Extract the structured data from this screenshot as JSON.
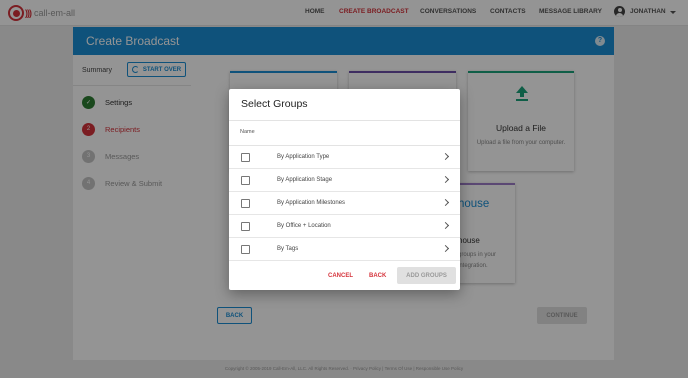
{
  "brand": {
    "name": "call-em-all",
    "accent": "#d5333b",
    "primary": "#1a8ed4"
  },
  "nav": {
    "items": [
      {
        "label": "HOME",
        "active": false
      },
      {
        "label": "CREATE BROADCAST",
        "active": true
      },
      {
        "label": "CONVERSATIONS",
        "active": false
      },
      {
        "label": "CONTACTS",
        "active": false
      },
      {
        "label": "MESSAGE LIBRARY",
        "active": false
      }
    ],
    "user": "JONATHAN"
  },
  "header": {
    "title": "Create Broadcast",
    "help_icon": "question-circle-icon"
  },
  "sidebar": {
    "summary_label": "Summary",
    "start_over_label": "START OVER",
    "steps": [
      {
        "number": "✓",
        "label": "Settings",
        "state": "done"
      },
      {
        "number": "2",
        "label": "Recipients",
        "state": "current"
      },
      {
        "number": "3",
        "label": "Messages",
        "state": "pending"
      },
      {
        "number": "4",
        "label": "Review & Submit",
        "state": "pending"
      }
    ]
  },
  "main": {
    "upload_card": {
      "title": "Upload a File",
      "description": "Upload a file from your computer."
    },
    "integration_card": {
      "logo_text": "house",
      "title": "house",
      "description": "groups in your integration."
    },
    "back_label": "BACK",
    "continue_label": "CONTINUE"
  },
  "footer": {
    "text": "Copyright © 2005-2019 Call-Em-All, LLC. All Rights Reserved. · Privacy Policy | Terms Of Use | Responsible Use Policy"
  },
  "dialog": {
    "title": "Select Groups",
    "column_header": "Name",
    "rows": [
      {
        "label": "By Application Type"
      },
      {
        "label": "By Application Stage"
      },
      {
        "label": "By Application Milestones"
      },
      {
        "label": "By Office + Location"
      },
      {
        "label": "By Tags"
      }
    ],
    "cancel_label": "CANCEL",
    "back_label": "BACK",
    "add_groups_label": "ADD GROUPS"
  }
}
